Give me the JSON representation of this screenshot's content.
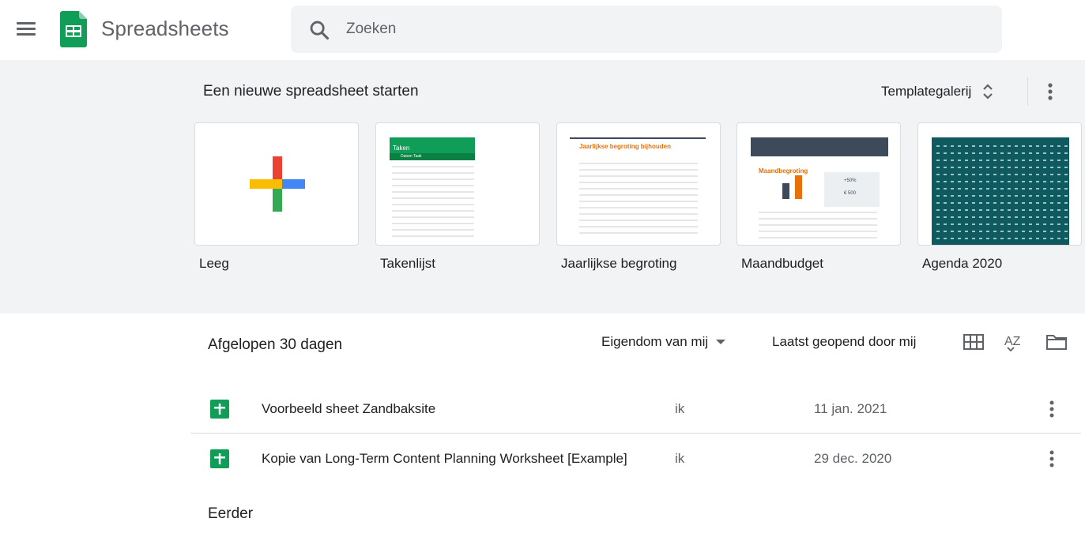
{
  "app": {
    "title": "Spreadsheets",
    "brand_color": "#0f9d58"
  },
  "search": {
    "placeholder": "Zoeken"
  },
  "templates": {
    "heading": "Een nieuwe spreadsheet starten",
    "gallery_label": "Templategalerij",
    "items": [
      {
        "label": "Leeg"
      },
      {
        "label": "Takenlijst",
        "preview_title": "Taken",
        "columns": [
          "Datum",
          "Taak"
        ]
      },
      {
        "label": "Jaarlijkse begroting",
        "preview_title": "Jaarlijkse begroting bijhouden"
      },
      {
        "label": "Maandbudget",
        "preview_title": "Maandbegroting",
        "stat": "+50%",
        "amount": "€ 500"
      },
      {
        "label": "Agenda 2020"
      }
    ]
  },
  "recent": {
    "heading": "Afgelopen 30 dagen",
    "owner_filter": "Eigendom van mij",
    "sort_label": "Laatst geopend door mij",
    "files": [
      {
        "name": "Voorbeeld sheet Zandbaksite",
        "owner": "ik",
        "date": "11 jan. 2021"
      },
      {
        "name": "Kopie van Long-Term Content Planning Worksheet [Example]",
        "owner": "ik",
        "date": "29 dec. 2020"
      }
    ],
    "earlier_heading": "Eerder"
  }
}
